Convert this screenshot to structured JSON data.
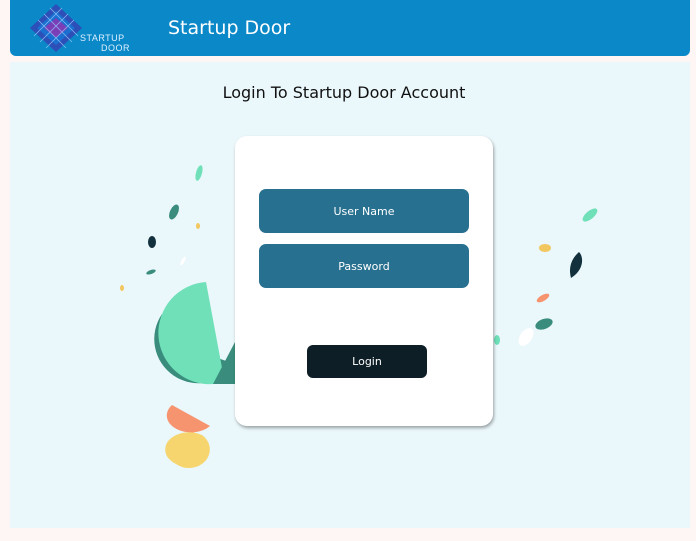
{
  "header": {
    "logo_line1": "STARTUP",
    "logo_line2": "DOOR",
    "title": "Startup Door"
  },
  "main": {
    "heading": "Login To Startup Door Account"
  },
  "login_form": {
    "username_placeholder": "User Name",
    "password_placeholder": "Password",
    "login_label": "Login"
  },
  "colors": {
    "header": "#0a88c8",
    "page_background": "#eaf7fb",
    "field": "#28708f",
    "button": "#0e1e26"
  }
}
